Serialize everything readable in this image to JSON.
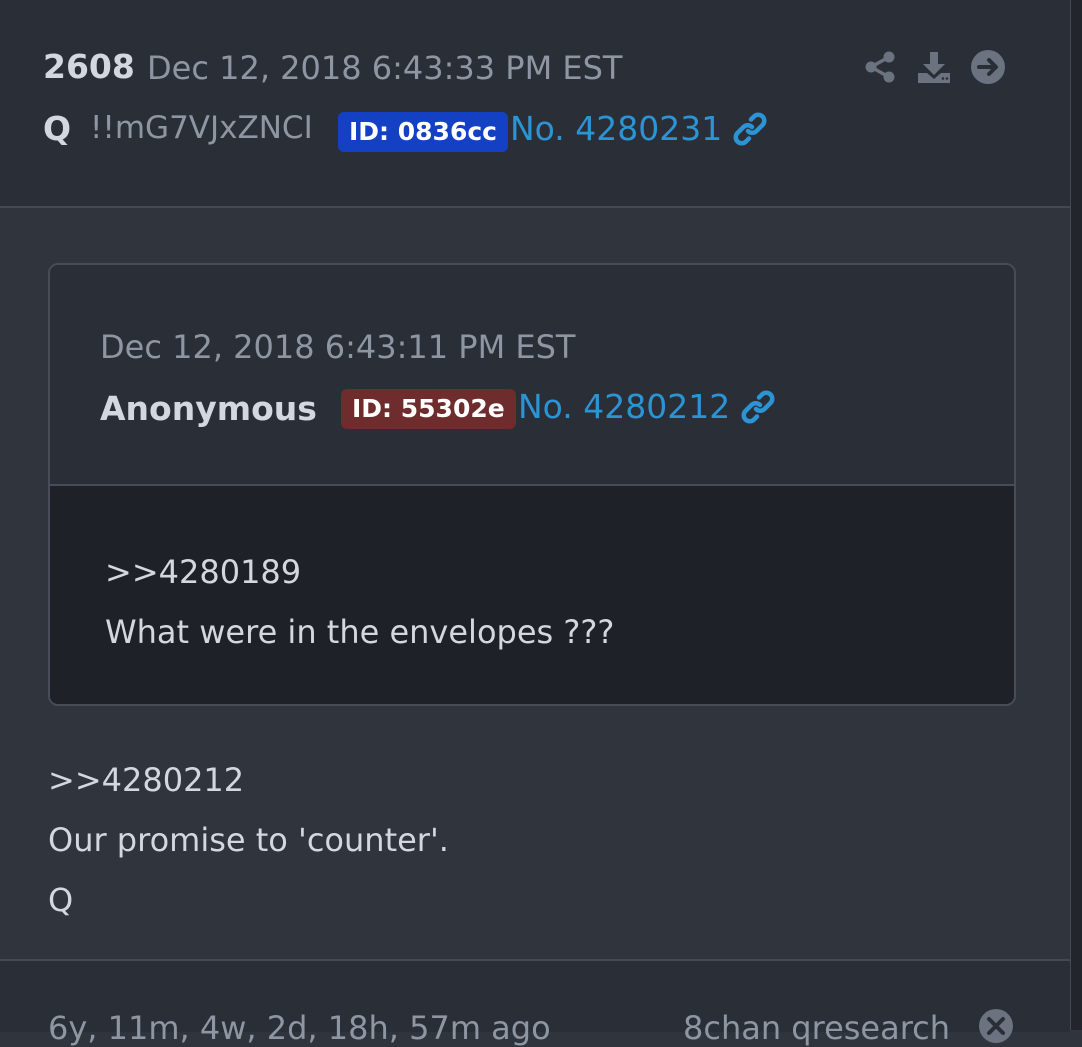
{
  "post": {
    "number": "2608",
    "date": "Dec 12, 2018 6:43:33 PM EST",
    "author": "Q",
    "tripcode": "!!mG7VJxZNCI",
    "id_badge": "ID: 0836cc",
    "post_no": "No. 4280231",
    "body": [
      ">>4280212",
      "Our promise to 'counter'.",
      "Q"
    ],
    "actions": [
      "share-icon",
      "download-icon",
      "arrow-right-circle-icon"
    ]
  },
  "quote": {
    "date": "Dec 12, 2018 6:43:11 PM EST",
    "author": "Anonymous",
    "id_badge": "ID: 55302e",
    "post_no": "No. 4280212",
    "body": [
      ">>4280189",
      "What were in the envelopes ???"
    ]
  },
  "footer": {
    "ago": "6y, 11m, 4w, 2d, 18h, 57m ago",
    "source": "8chan qresearch"
  },
  "colors": {
    "background": "#2f343d",
    "header_bg": "#2a2e36",
    "quote_body_bg": "#1f2128",
    "link": "#2c94d4",
    "q_badge": "#1440c4",
    "anon_badge": "#6e2c2c",
    "muted_text": "#8f96a3",
    "text": "#d3d7de"
  }
}
